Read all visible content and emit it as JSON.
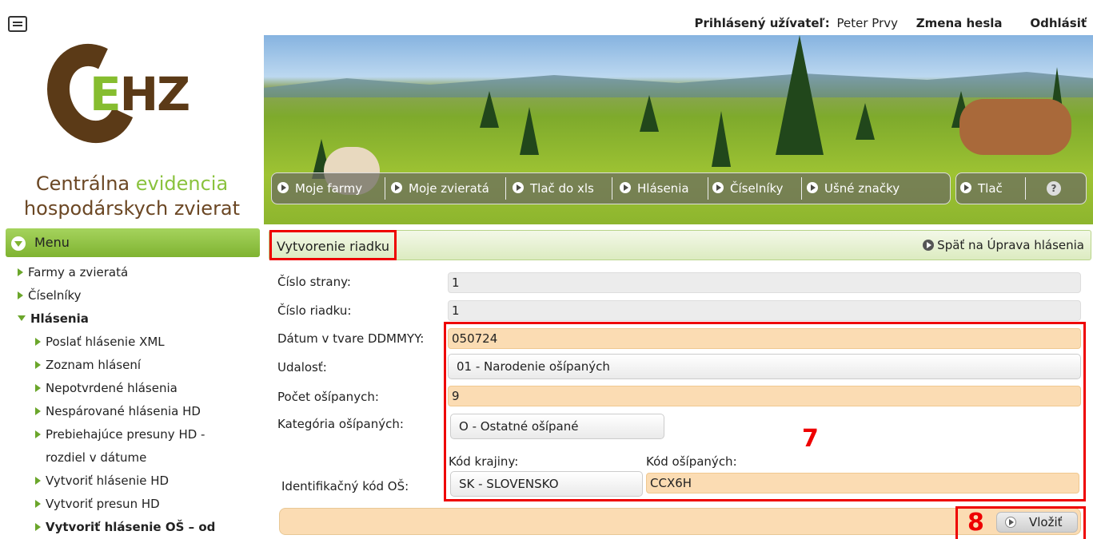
{
  "header": {
    "user_label": "Prihlásený užívateľ:",
    "user_name": "Peter Prvy",
    "change_password": "Zmena hesla",
    "logout": "Odhlásiť"
  },
  "brand": {
    "logo_text": "EHZ",
    "line1_a": "Centrálna",
    "line1_b": "evidencia",
    "line2": "hospodárskych zvierat"
  },
  "nav": {
    "items": [
      "Moje farmy",
      "Moje zvieratá",
      "Tlač do xls",
      "Hlásenia",
      "Číselníky",
      "Ušné značky",
      "Tlač"
    ],
    "help": "?"
  },
  "menu": {
    "title": "Menu",
    "items": [
      "Farmy a zvieratá",
      "Číselníky",
      "Hlásenia",
      "Poslať hlásenie XML",
      "Zoznam hlásení",
      "Nepotvrdené hlásenia",
      "Nespárované hlásenia HD",
      "Prebiehajúce presuny HD -",
      "rozdiel v dátume",
      "Vytvoriť hlásenie HD",
      "Vytvoriť presun HD",
      "Vytvoriť hlásenie OŠ – od"
    ]
  },
  "content": {
    "title": "Vytvorenie riadku",
    "back_link": "Späť na Úprava hlásenia"
  },
  "form": {
    "page_no_label": "Číslo strany:",
    "page_no": "1",
    "row_no_label": "Číslo riadku:",
    "row_no": "1",
    "date_label": "Dátum v tvare DDMMYY:",
    "date": "050724",
    "event_label": "Udalosť:",
    "event": "01 - Narodenie ošípaných",
    "count_label": "Počet ošípanych:",
    "count": "9",
    "category_label": "Kategória ošípaných:",
    "category": "O - Ostatné ošípané",
    "country_code_label": "Kód krajiny:",
    "pig_code_label": "Kód ošípaných:",
    "id_label": "Identifikačný kód OŠ:",
    "country": "SK - SLOVENSKO",
    "pig_code": "CCX6H",
    "submit": "Vložiť"
  },
  "annotations": {
    "box7": "7",
    "box8": "8"
  },
  "colors": {
    "accent_green": "#8ac23d",
    "brown": "#5b3a17",
    "field_orange": "#fbdcb3",
    "highlight_red": "#ee0000"
  }
}
